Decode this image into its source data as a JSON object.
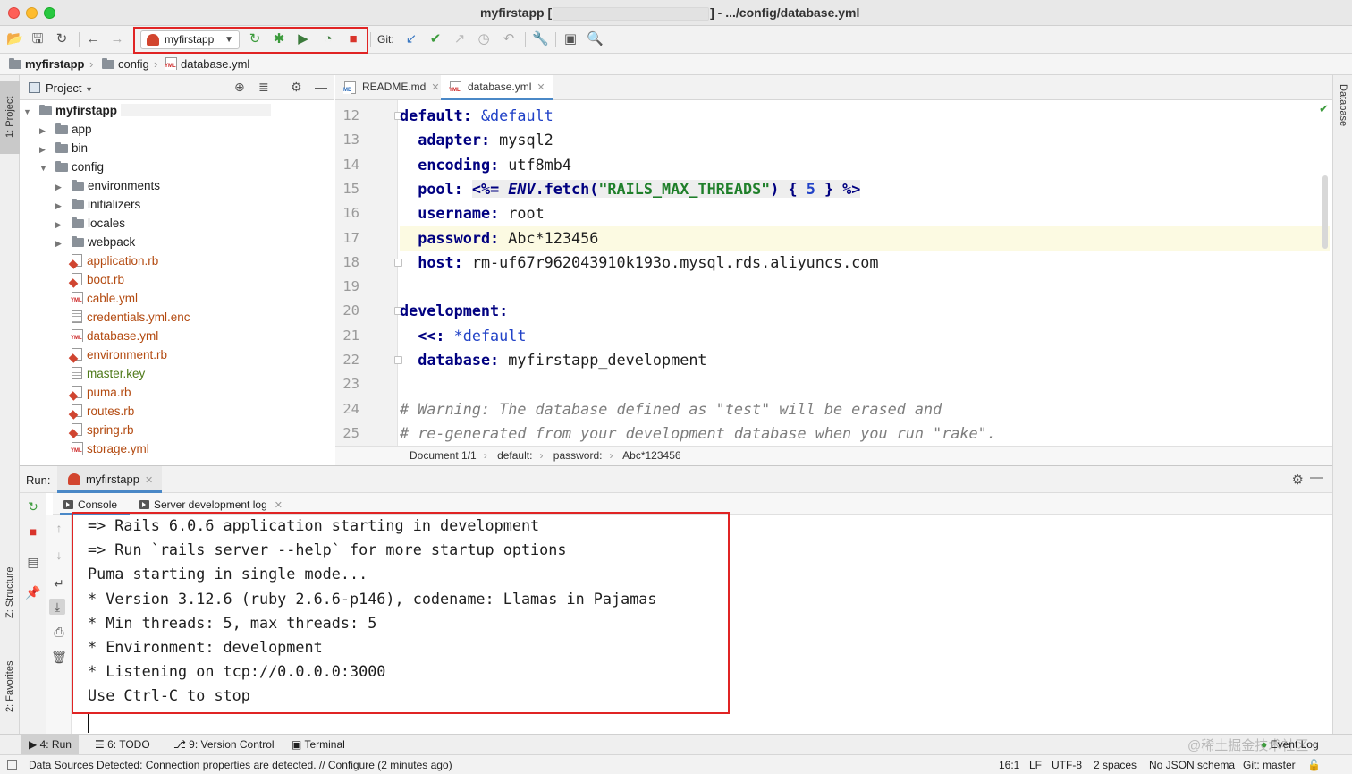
{
  "window": {
    "title_prefix": "myfirstapp [",
    "title_suffix": "] - .../config/database.yml"
  },
  "toolbar": {
    "run_config": "myfirstapp",
    "git_label": "Git:",
    "icons": [
      "open-folder-icon",
      "save-icon",
      "sync-icon",
      "back-icon",
      "forward-icon",
      "rerun-icon",
      "debug-icon",
      "coverage-icon",
      "profile-icon",
      "stop-icon",
      "git-update-icon",
      "git-commit-icon",
      "git-push-icon",
      "history-icon",
      "rollback-icon",
      "wrench-icon",
      "terminal-icon",
      "search-icon"
    ]
  },
  "navbar": {
    "crumbs": [
      "myfirstapp",
      "config",
      "database.yml"
    ]
  },
  "left_strip": {
    "project_tab": "1: Project",
    "structure_tab": "Z: Structure",
    "favorites_tab": "2: Favorites"
  },
  "right_strip": {
    "database_tab": "Database"
  },
  "project": {
    "title": "Project",
    "tree": [
      {
        "label": "myfirstapp",
        "kind": "root",
        "depth": 0
      },
      {
        "label": "app",
        "kind": "folder",
        "depth": 1
      },
      {
        "label": "bin",
        "kind": "folder",
        "depth": 1
      },
      {
        "label": "config",
        "kind": "folder-open",
        "depth": 1
      },
      {
        "label": "environments",
        "kind": "folder",
        "depth": 2
      },
      {
        "label": "initializers",
        "kind": "folder",
        "depth": 2
      },
      {
        "label": "locales",
        "kind": "folder",
        "depth": 2
      },
      {
        "label": "webpack",
        "kind": "folder",
        "depth": 2
      },
      {
        "label": "application.rb",
        "kind": "rb",
        "depth": 2
      },
      {
        "label": "boot.rb",
        "kind": "rb",
        "depth": 2
      },
      {
        "label": "cable.yml",
        "kind": "yml",
        "depth": 2
      },
      {
        "label": "credentials.yml.enc",
        "kind": "txt",
        "depth": 2
      },
      {
        "label": "database.yml",
        "kind": "yml",
        "depth": 2
      },
      {
        "label": "environment.rb",
        "kind": "rb",
        "depth": 2
      },
      {
        "label": "master.key",
        "kind": "key",
        "depth": 2
      },
      {
        "label": "puma.rb",
        "kind": "rb",
        "depth": 2
      },
      {
        "label": "routes.rb",
        "kind": "rb",
        "depth": 2
      },
      {
        "label": "spring.rb",
        "kind": "rb",
        "depth": 2
      },
      {
        "label": "storage.yml",
        "kind": "yml",
        "depth": 2
      }
    ]
  },
  "editor": {
    "tabs": [
      {
        "label": "README.md",
        "active": false
      },
      {
        "label": "database.yml",
        "active": true
      }
    ],
    "lines": [
      {
        "n": "12",
        "kind": "default_anchor"
      },
      {
        "n": "13",
        "kind": "kv",
        "key": "adapter:",
        "value": " mysql2"
      },
      {
        "n": "14",
        "kind": "kv",
        "key": "encoding:",
        "value": " utf8mb4"
      },
      {
        "n": "15",
        "kind": "pool"
      },
      {
        "n": "16",
        "kind": "kv",
        "key": "username:",
        "value": " root"
      },
      {
        "n": "17",
        "kind": "kv",
        "key": "password:",
        "value": " Abc*123456",
        "highlight": true
      },
      {
        "n": "18",
        "kind": "kv",
        "key": "host:",
        "value": " rm-uf67r962043910k193o.mysql.rds.aliyuncs.com"
      },
      {
        "n": "19",
        "kind": "blank"
      },
      {
        "n": "20",
        "kind": "section",
        "key": "development:"
      },
      {
        "n": "21",
        "kind": "merge"
      },
      {
        "n": "22",
        "kind": "kv",
        "key": "database:",
        "value": " myfirstapp_development"
      },
      {
        "n": "23",
        "kind": "blank"
      },
      {
        "n": "24",
        "kind": "comment",
        "text": "# Warning: The database defined as \"test\" will be erased and"
      },
      {
        "n": "25",
        "kind": "comment",
        "text": "# re-generated from your development database when you run \"rake\"."
      }
    ],
    "tokens": {
      "default_key": "default:",
      "default_anchor": "&default",
      "pool_key": "pool:",
      "erb_open": "<%=",
      "env_const": "ENV",
      "fetch": ".fetch(",
      "env_str": "\"RAILS_MAX_THREADS\"",
      "rparen": ")",
      "brace_open": "{",
      "five": "5",
      "brace_close": "}",
      "erb_close": "%>",
      "merge_key": "<<:",
      "merge_ref": "*default"
    },
    "breadcrumbs": [
      "Document 1/1",
      "default:",
      "password:",
      "Abc*123456"
    ]
  },
  "run": {
    "label": "Run:",
    "tab": "myfirstapp",
    "subtabs": [
      "Console",
      "Server development log"
    ],
    "console_lines": [
      "=> Rails 6.0.6 application starting in development",
      "=> Run `rails server --help` for more startup options",
      "Puma starting in single mode...",
      "* Version 3.12.6 (ruby 2.6.6-p146), codename: Llamas in Pajamas",
      "* Min threads: 5, max threads: 5",
      "* Environment: development",
      "* Listening on tcp://0.0.0.0:3000",
      "Use Ctrl-C to stop"
    ]
  },
  "bottom_tools": {
    "run": "4: Run",
    "todo": "6: TODO",
    "vcs": "9: Version Control",
    "terminal": "Terminal",
    "event_log": "Event Log",
    "watermark": "@稀土掘金技术社区"
  },
  "status": {
    "message": "Data Sources Detected: Connection properties are detected. // Configure (2 minutes ago)",
    "position": "16:1",
    "line_sep": "LF",
    "encoding": "UTF-8",
    "indent": "2 spaces",
    "schema": "No JSON schema",
    "git": "Git: master"
  }
}
